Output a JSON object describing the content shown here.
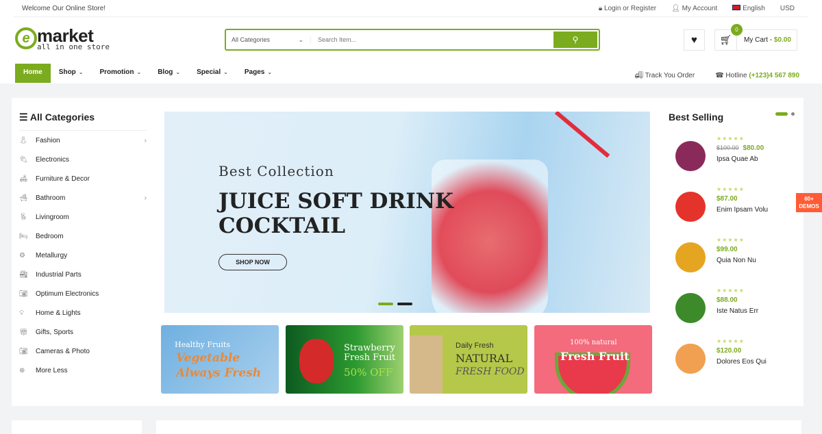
{
  "topbar": {
    "welcome": "Welcome Our Online Store!",
    "login": "Login or Register",
    "account": "My Account",
    "language": "English",
    "currency": "USD"
  },
  "logo": {
    "name": "market",
    "tagline": "all in one store",
    "letter": "e"
  },
  "search": {
    "category": "All Categories",
    "placeholder": "Search Item..."
  },
  "cart": {
    "count": "0",
    "label": "My Cart - ",
    "total": "$0.00"
  },
  "nav": {
    "items": [
      "Home",
      "Shop",
      "Promotion",
      "Blog",
      "Special",
      "Pages"
    ],
    "track": "Track You Order",
    "hotline_label": "Hotline ",
    "hotline": "(+123)4 567 890"
  },
  "categories": {
    "title": "All Categories",
    "items": [
      "Fashion",
      "Electronics",
      "Furniture & Decor",
      "Bathroom",
      "Livingroom",
      "Bedroom",
      "Metallurgy",
      "Industrial Parts",
      "Optimum Electronics",
      "Home & Lights",
      "Gifts, Sports",
      "Cameras & Photo",
      "More Less"
    ]
  },
  "hero": {
    "subtitle": "Best Collection",
    "title_line1": "JUICE SOFT DRINK",
    "title_line2": "COCKTAIL",
    "button": "SHOP NOW"
  },
  "banners": [
    {
      "line1": "Healthy Fruits",
      "line2": "Vegetable",
      "line3": "Always Fresh"
    },
    {
      "line1": "Strawberry",
      "line2": "Fresh Fruit",
      "line3": "50% OFF"
    },
    {
      "line1": "Daily Fresh",
      "line2": "NATURAL",
      "line3": "FRESH FOOD"
    },
    {
      "line1": "100% natural",
      "line2": "Fresh Fruit"
    }
  ],
  "best_selling": {
    "title": "Best Selling",
    "products": [
      {
        "name": "Ipsa Quae Ab",
        "price": "$80.00",
        "old_price": "$100.00",
        "color": "#8a2a5a"
      },
      {
        "name": "Enim Ipsam Volu",
        "price": "$87.00",
        "color": "#e4332b"
      },
      {
        "name": "Quia Non Nu",
        "price": "$99.00",
        "color": "#e6a520"
      },
      {
        "name": "Iste Natus Err",
        "price": "$88.00",
        "color": "#3d8a2a"
      },
      {
        "name": "Dolores Eos Qui",
        "price": "$120.00",
        "color": "#f0a050"
      }
    ]
  },
  "demos": {
    "line1": "60+",
    "line2": "DEMOS"
  },
  "colors": {
    "accent": "#7bab1e",
    "demo_badge": "#ff5c35"
  }
}
